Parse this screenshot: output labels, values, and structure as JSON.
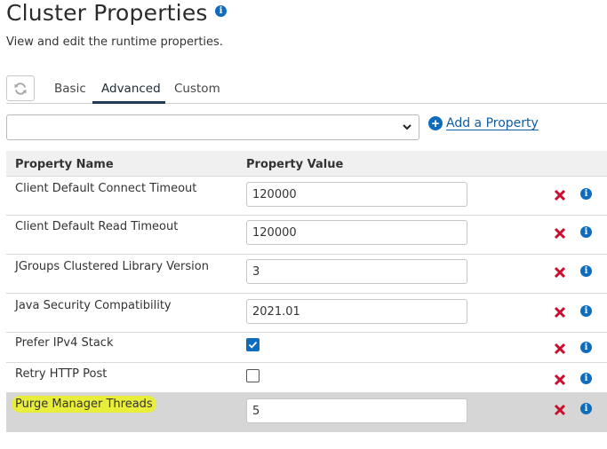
{
  "header": {
    "title": "Cluster Properties",
    "subtitle": "View and edit the runtime properties."
  },
  "icons": {
    "title_info": "info-icon",
    "refresh": "refresh-icon",
    "add": "plus-circle-icon",
    "delete": "x-icon",
    "row_info": "info-icon"
  },
  "tabs": [
    {
      "label": "Basic",
      "active": false
    },
    {
      "label": "Advanced",
      "active": true
    },
    {
      "label": "Custom",
      "active": false
    }
  ],
  "filter": {
    "selected_value": ""
  },
  "add_property_label": "Add a Property",
  "table": {
    "columns": [
      "Property Name",
      "Property Value"
    ],
    "rows": [
      {
        "name": "Client Default Connect Timeout",
        "type": "text",
        "value": "120000"
      },
      {
        "name": "Client Default Read Timeout",
        "type": "text",
        "value": "120000"
      },
      {
        "name": "JGroups Clustered Library Version",
        "type": "text",
        "value": "3"
      },
      {
        "name": "Java Security Compatibility",
        "type": "text",
        "value": "2021.01"
      },
      {
        "name": "Prefer IPv4 Stack",
        "type": "checkbox",
        "checked": true
      },
      {
        "name": "Retry HTTP Post",
        "type": "checkbox",
        "checked": false
      },
      {
        "name": "Purge Manager Threads",
        "type": "text",
        "value": "5",
        "highlighted": true
      }
    ]
  },
  "colors": {
    "accent": "#0f6cbd",
    "delete": "#c8102e",
    "highlight": "#e8ee3a",
    "selected_row": "#d6d6d6"
  }
}
